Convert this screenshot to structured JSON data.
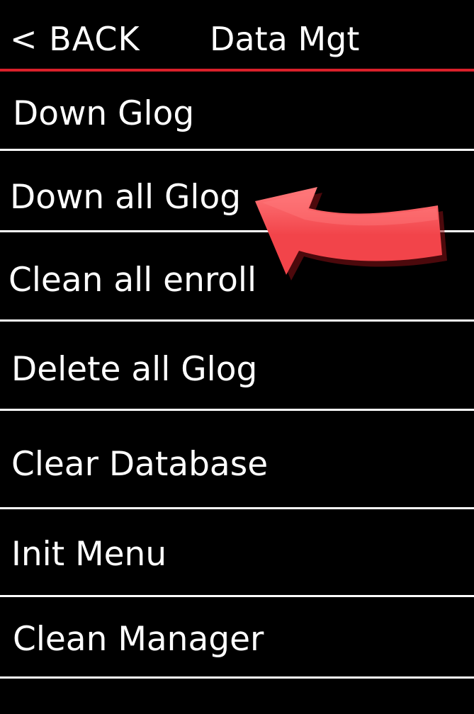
{
  "colors": {
    "background": "#000000",
    "text": "#ffffff",
    "accent_rule": "#d9202a",
    "divider": "#ffffff",
    "arrow_fill": "#f2444a",
    "arrow_highlight": "#ff7a7c",
    "arrow_shadow": "#8a1015"
  },
  "header": {
    "back_label": "< BACK",
    "title": "Data Mgt"
  },
  "menu": {
    "items": [
      {
        "label": "Down Glog"
      },
      {
        "label": "Down all Glog"
      },
      {
        "label": "Clean all enroll"
      },
      {
        "label": "Delete all Glog"
      },
      {
        "label": "Clear Database"
      },
      {
        "label": "Init Menu"
      },
      {
        "label": "Clean Manager"
      }
    ]
  },
  "annotation": {
    "icon": "curved-arrow-icon",
    "points_to": "Down all Glog"
  }
}
